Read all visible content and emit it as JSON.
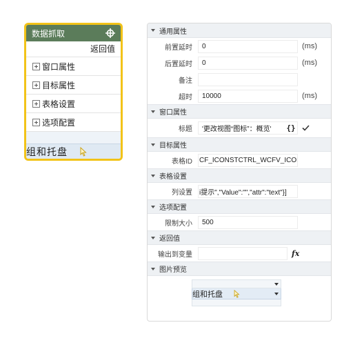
{
  "widget": {
    "title": "数据抓取",
    "header_icon": "crosshair-icon",
    "return_label": "返回值",
    "groups": [
      "窗口属性",
      "目标属性",
      "表格设置",
      "选项配置"
    ],
    "footer_text": "组和托盘",
    "colors": {
      "border": "#f2c318",
      "header": "#5b7c5a"
    }
  },
  "panel": {
    "sections": {
      "general": "通用属性",
      "window": "窗口属性",
      "target": "目标属性",
      "table": "表格设置",
      "options": "选项配置",
      "return": "返回值",
      "preview": "图片预览"
    },
    "general": {
      "pre_delay_label": "前置延时",
      "pre_delay_value": "0",
      "pre_delay_unit": "(ms)",
      "post_delay_label": "后置延时",
      "post_delay_value": "0",
      "post_delay_unit": "(ms)",
      "note_label": "备注",
      "note_value": "",
      "timeout_label": "超时",
      "timeout_value": "10000",
      "timeout_unit": "(ms)"
    },
    "window": {
      "title_label": "标题",
      "title_value": "'更改视图“图标”：概览'",
      "brace_label": "{}"
    },
    "target": {
      "table_id_label": "表格ID",
      "table_id_value": "CF_ICONSTCTRL_WCFV_ICON'"
    },
    "table": {
      "column_label": "列设置",
      "column_value": "i提示\",\"Value\":\"\",\"attr\":\"text\"}]"
    },
    "options": {
      "limit_label": "限制大小",
      "limit_value": "500"
    },
    "return": {
      "output_label": "输出到变量",
      "output_value": "",
      "fx_label": "fx"
    },
    "preview": {
      "text": "组和托盘"
    }
  }
}
